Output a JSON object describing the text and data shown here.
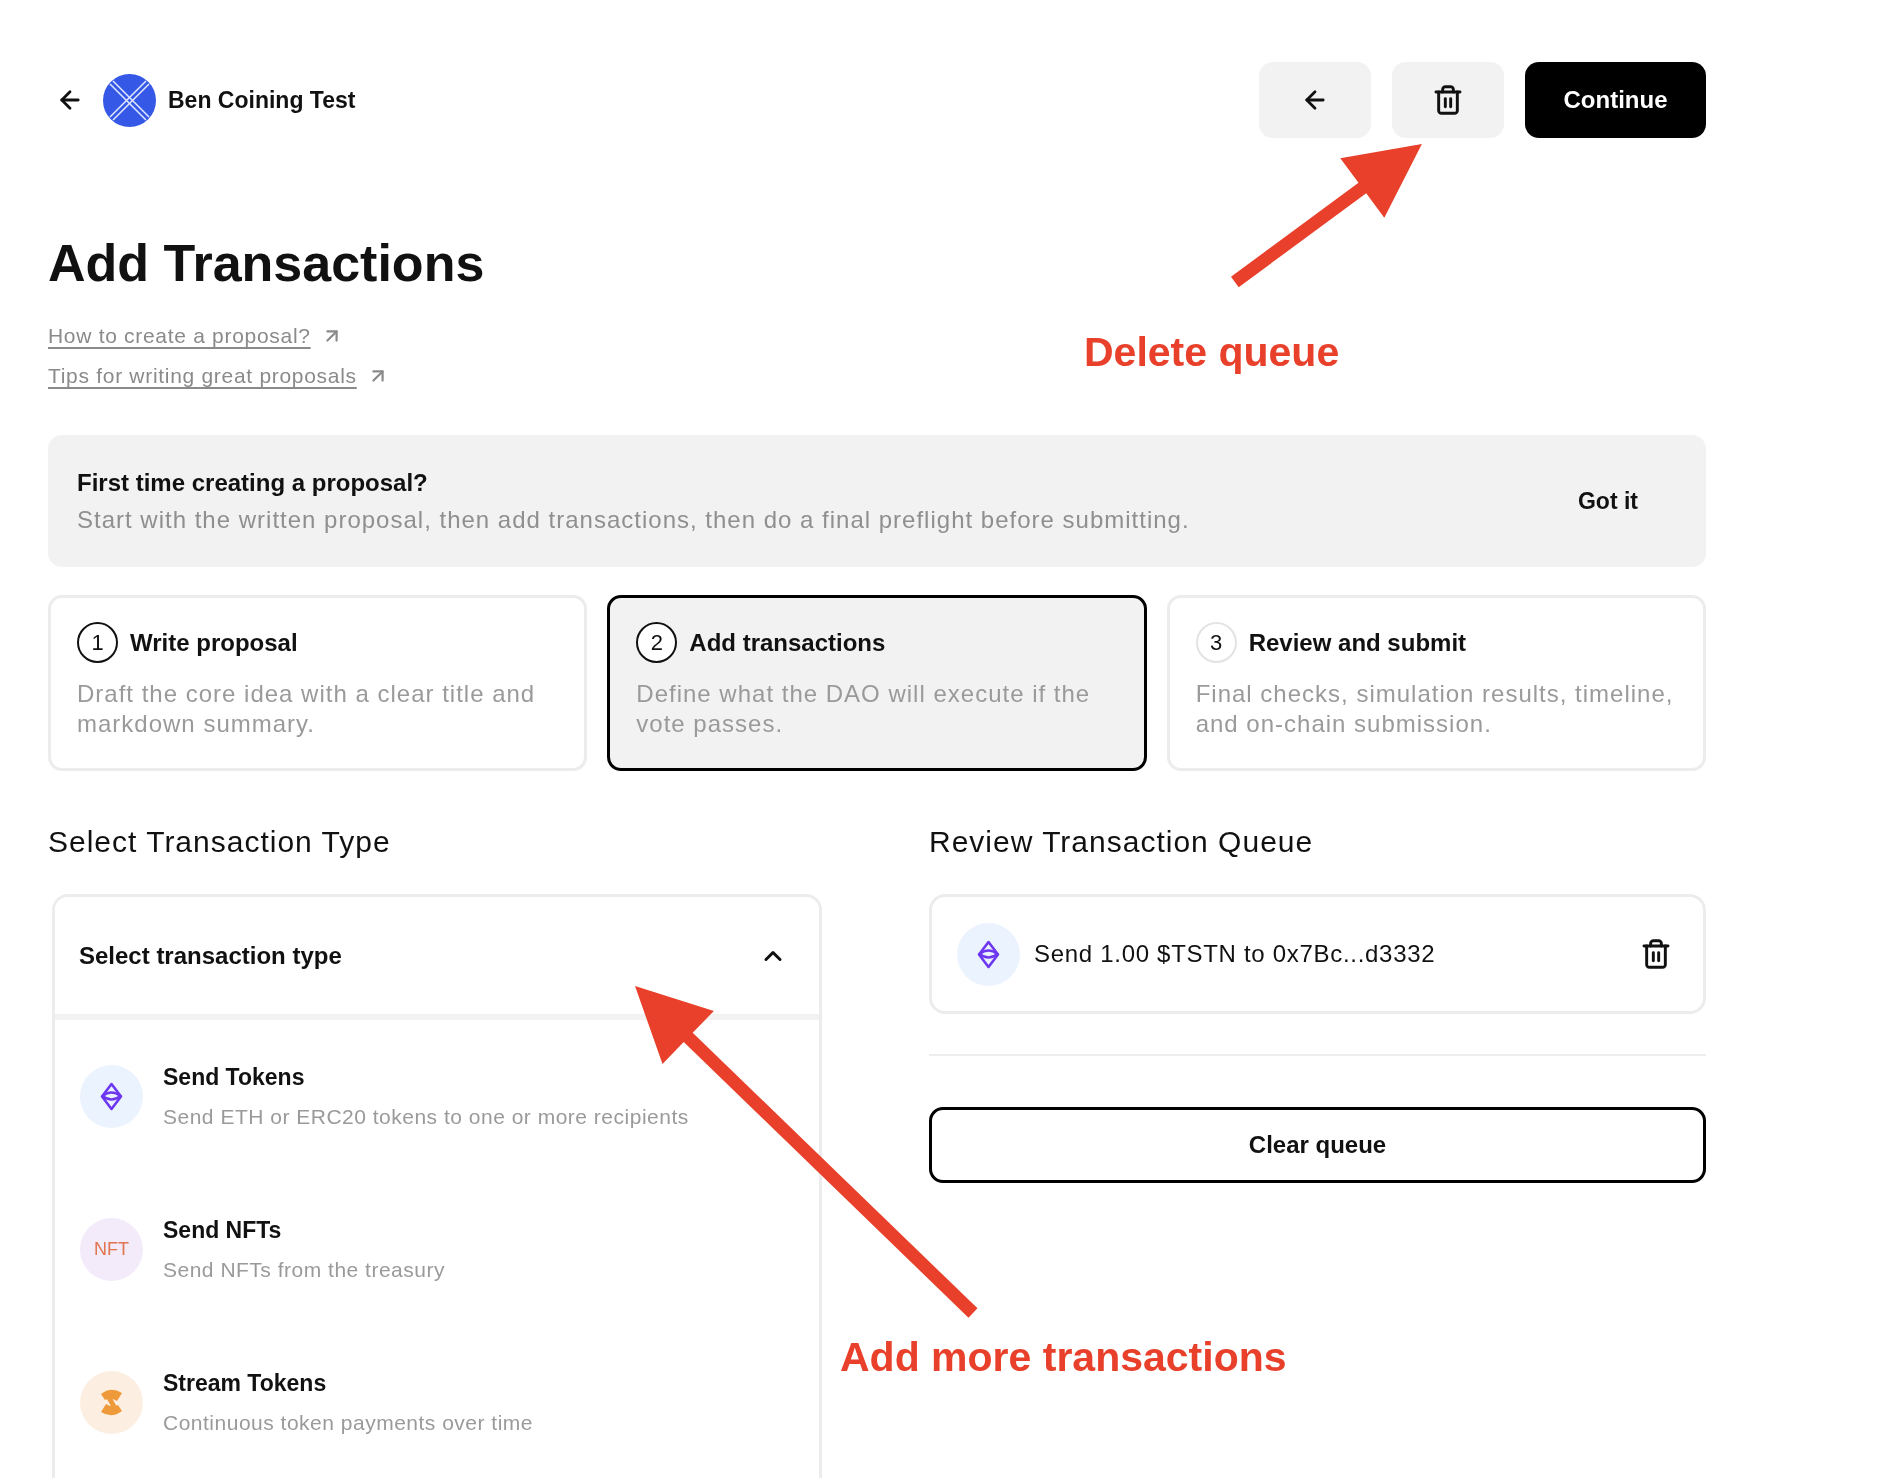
{
  "header": {
    "dao_name": "Ben Coining Test",
    "continue_button": "Continue"
  },
  "page_title": "Add Transactions",
  "help_links": [
    "How to create a proposal?",
    "Tips for writing great proposals"
  ],
  "notice": {
    "title": "First time creating a proposal?",
    "text": "Start with the written proposal, then add transactions, then do a final preflight before submitting.",
    "dismiss": "Got it"
  },
  "steps": [
    {
      "number": "1",
      "title": "Write proposal",
      "description": "Draft the core idea with a clear title and markdown summary.",
      "selected": false,
      "reached": true
    },
    {
      "number": "2",
      "title": "Add transactions",
      "description": "Define what the DAO will execute if the vote passes.",
      "selected": true,
      "reached": true
    },
    {
      "number": "3",
      "title": "Review and submit",
      "description": "Final checks, simulation results, timeline, and on-chain submission.",
      "selected": false,
      "reached": false
    }
  ],
  "transaction_types": {
    "heading": "Select Transaction Type",
    "dropdown": {
      "label": "Select transaction type",
      "expanded": true
    },
    "options": [
      {
        "kind": "token",
        "title": "Send Tokens",
        "description": "Send ETH or ERC20 tokens to one or more recipients"
      },
      {
        "kind": "nft",
        "badge": "NFT",
        "title": "Send NFTs",
        "description": "Send NFTs from the treasury"
      },
      {
        "kind": "stream",
        "title": "Stream Tokens",
        "description": "Continuous token payments over time"
      }
    ]
  },
  "queue": {
    "heading": "Review Transaction Queue",
    "items": [
      {
        "kind": "token",
        "text": "Send 1.00 $TSTN to 0x7Bc...d3332"
      }
    ],
    "clear_button": "Clear queue"
  },
  "annotations": [
    {
      "kind": "arrow-callout",
      "text": "Delete queue"
    },
    {
      "kind": "arrow-callout",
      "text": "Add more transactions"
    }
  ]
}
